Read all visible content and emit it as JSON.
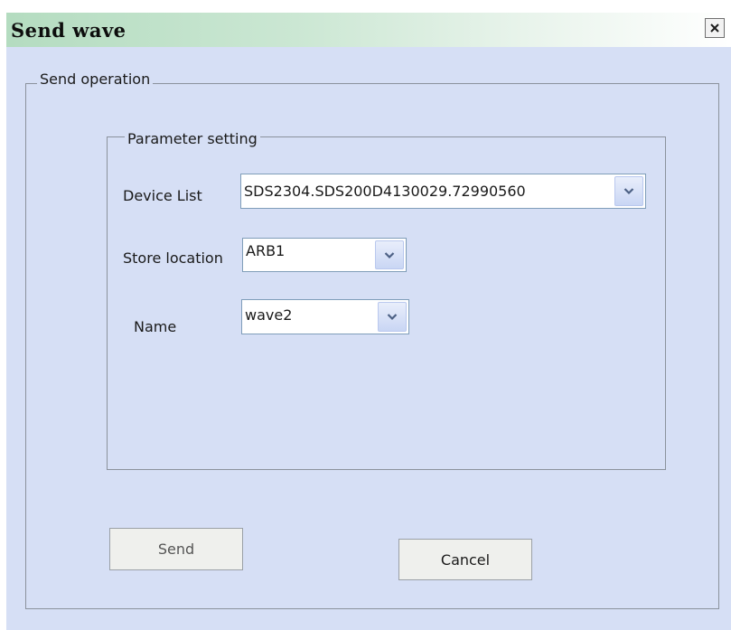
{
  "window": {
    "title": "Send wave",
    "close_label": "x"
  },
  "send_operation": {
    "legend": "Send operation",
    "parameter_setting": {
      "legend": "Parameter  setting",
      "device_list": {
        "label": "Device List",
        "value": "SDS2304.SDS200D4130029.72990560"
      },
      "store_location": {
        "label": "Store location",
        "value": "ARB1"
      },
      "name": {
        "label": "Name",
        "value": "wave2"
      }
    }
  },
  "buttons": {
    "send": "Send",
    "cancel": "Cancel"
  },
  "icons": {
    "close": "close-icon",
    "dropdown": "chevron-down-icon"
  },
  "colors": {
    "window_bg": "#d6dff5",
    "titlebar_start": "#b4dcc0",
    "combo_border": "#7f9db9"
  }
}
